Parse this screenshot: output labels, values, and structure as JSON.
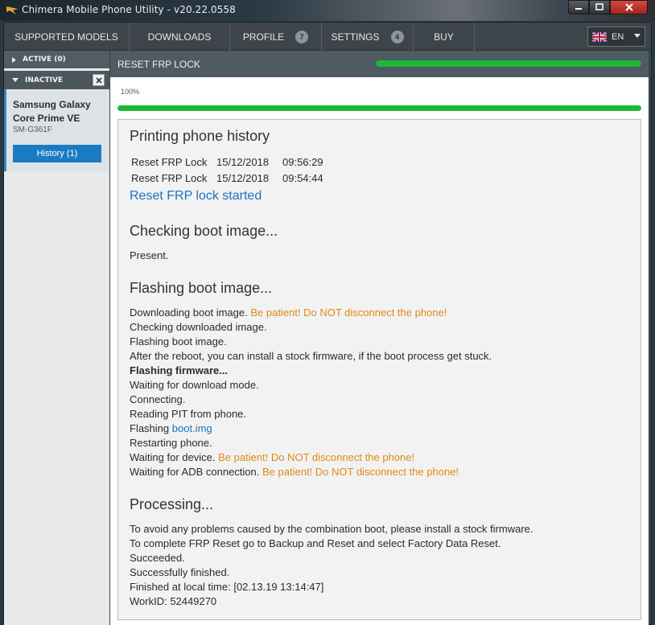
{
  "window": {
    "title": "Chimera Mobile Phone Utility - v20.22.0558",
    "controls": [
      "minimize",
      "maximize",
      "close"
    ]
  },
  "nav": {
    "items": [
      {
        "label": "SUPPORTED MODELS"
      },
      {
        "label": "DOWNLOADS"
      },
      {
        "label": "PROFILE",
        "badge": "7"
      },
      {
        "label": "SETTINGS",
        "badge": "4"
      },
      {
        "label": "BUY"
      }
    ],
    "language": {
      "code": "EN",
      "icon": "uk-flag-icon"
    }
  },
  "sidebar": {
    "active_label": "ACTIVE (0)",
    "inactive_label": "INACTIVE",
    "device": {
      "name": "Samsung Galaxy Core Prime VE",
      "model": "SM-G361F",
      "history_button": "History (1)"
    }
  },
  "operation": {
    "title": "RESET FRP LOCK",
    "progress_text": "100%",
    "progress_value": 1.0
  },
  "log": {
    "printing_title": "Printing phone history",
    "history": [
      {
        "operation": "Reset FRP Lock",
        "date": "15/12/2018",
        "time": "09:56:29"
      },
      {
        "operation": "Reset FRP Lock",
        "date": "15/12/2018",
        "time": "09:54:44"
      }
    ],
    "started": "Reset FRP lock started",
    "checking_title": "Checking boot image...",
    "present": "Present.",
    "flashing_title": "Flashing boot image...",
    "downloading": "Downloading boot image.",
    "warning": "Be patient! Do NOT disconnect the phone!",
    "checking_downloaded": "Checking downloaded image.",
    "flashing_boot": "Flashing boot image.",
    "after_reboot": "After the reboot, you can install a stock firmware, if the boot process get stuck.",
    "flashing_firmware": "Flashing firmware...",
    "waiting_download": "Waiting for download mode.",
    "connecting": "Connecting.",
    "reading_pit": "Reading PIT from phone.",
    "flashing_prefix": "Flashing",
    "boot_img": "boot.img",
    "restarting": "Restarting phone.",
    "waiting_device": "Waiting for device.",
    "waiting_adb": "Waiting for ADB connection.",
    "processing_title": "Processing...",
    "avoid_problems": "To avoid any problems caused by the combination boot, please install a stock firmware.",
    "to_complete": "To complete FRP Reset go to Backup and Reset and select Factory Data Reset.",
    "succeeded": "Succeeded.",
    "successfully": "Successfully finished.",
    "finished_at": "Finished at local time: [02.13.19 13:14:47]",
    "workid": "WorkID: 52449270"
  },
  "colors": {
    "progress": "#1db838",
    "warning": "#e08a12",
    "link": "#1a73c4",
    "accent": "#1a7bc4"
  }
}
